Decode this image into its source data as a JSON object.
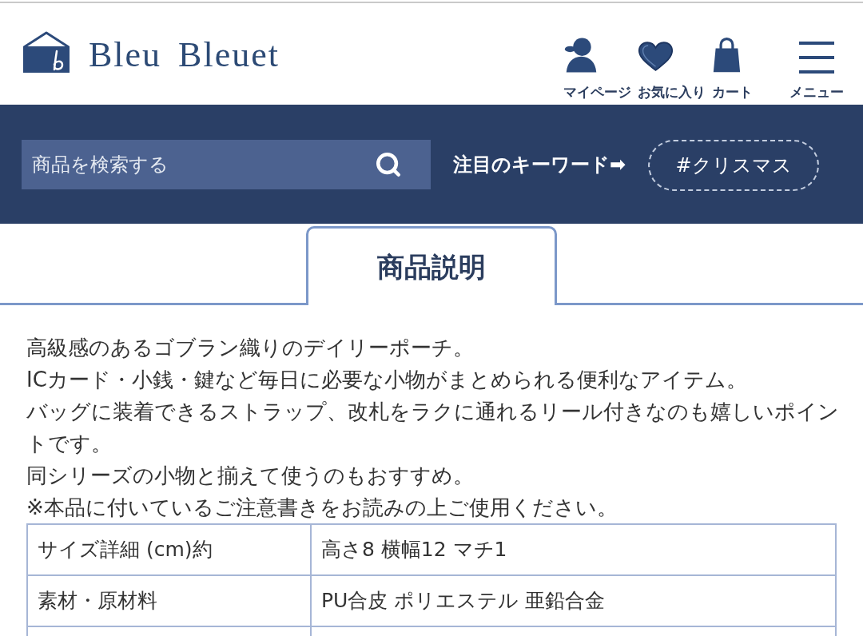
{
  "header": {
    "logo_text": "Bleu Bleuet",
    "nav": [
      {
        "kind": "account",
        "label": "マイページ"
      },
      {
        "kind": "favorites",
        "label": "お気に入り"
      },
      {
        "kind": "cart",
        "label": "カート"
      },
      {
        "kind": "menu",
        "label": "メニュー"
      }
    ]
  },
  "search": {
    "placeholder": "商品を検索する",
    "featured_label": "注目のキーワード➡",
    "keywords": [
      "#クリスマス"
    ]
  },
  "tabs": [
    {
      "label": "商品説明",
      "selected": true
    }
  ],
  "description": [
    "高級感のあるゴブラン織りのデイリーポーチ。",
    "ICカード・小銭・鍵など毎日に必要な小物がまとめられる便利なアイテム。",
    "バッグに装着できるストラップ、改札をラクに通れるリール付きなのも嬉しいポイントです。",
    "同シリーズの小物と揃えて使うのもおすすめ。",
    "※本品に付いているご注意書きをお読みの上ご使用ください。"
  ],
  "spec_table": {
    "rows": [
      [
        "サイズ詳細 (cm)約",
        "高さ8 横幅12 マチ1"
      ],
      [
        "素材・原材料",
        "PU合皮 ポリエステル 亜鉛合金"
      ]
    ]
  }
}
